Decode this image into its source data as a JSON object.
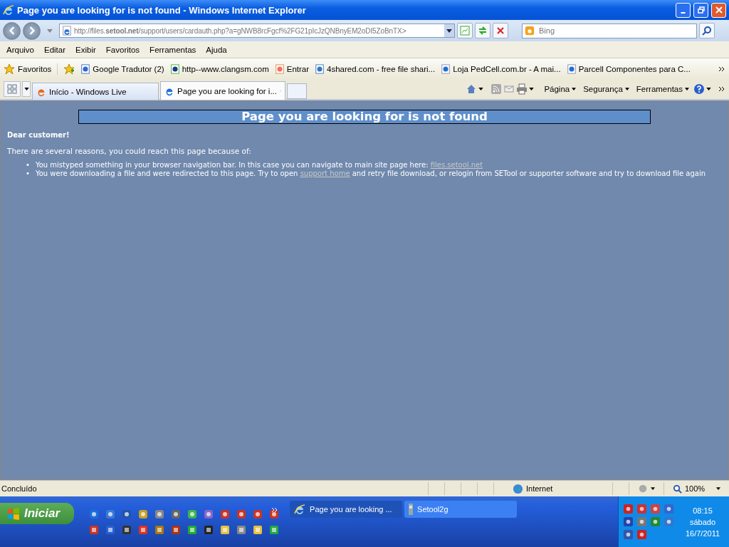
{
  "window": {
    "title": "Page you are looking for is not found - Windows Internet Explorer"
  },
  "address_bar": {
    "url": "http://files.**setool.net**/support/users/cardauth.php?a=gNWB8rcFgcf%2FG21pIcJzQNBnyEM2oDI5ZoBnTX>"
  },
  "search": {
    "placeholder": "Bing"
  },
  "menu": [
    "Arquivo",
    "Editar",
    "Exibir",
    "Favoritos",
    "Ferramentas",
    "Ajuda"
  ],
  "favorites_bar": {
    "label": "Favoritos",
    "links": [
      "Google Tradutor (2)",
      "http--www.clangsm.com",
      "Entrar",
      "4shared.com - free file shari...",
      "Loja PedCell.com.br - A mai...",
      "Parcell Componentes para C..."
    ]
  },
  "tabs": [
    {
      "title": "Início - Windows Live",
      "selected": false
    },
    {
      "title": "Page you are looking for i...",
      "selected": true
    }
  ],
  "command_bar": [
    "Página",
    "Segurança",
    "Ferramentas"
  ],
  "page": {
    "heading": "Page you are looking for is not found",
    "greeting": "Dear customer!",
    "intro": "There are several reasons, you could reach this page because of:",
    "reasons": [
      {
        "marker": "•",
        "text": "You mistyped something in your browser navigation bar. In this case you can navigate to main site page here: ",
        "link": "files.setool.net"
      },
      {
        "marker": "•",
        "text": "You were downloading a file and were redirected to this page. Try to open ",
        "link": "support home",
        "after": " and retry file download, or relogin from SETool or supporter software and try to download file again"
      }
    ]
  },
  "status_bar": {
    "status": "Concluído",
    "zone": "Internet",
    "zoom": "100%"
  },
  "taskbar": {
    "start": "Iniciar",
    "windows": [
      {
        "title": "Page you are looking ...",
        "selected": true
      },
      {
        "title": "Setool2g",
        "selected": false
      }
    ],
    "time": "08:15",
    "day": "sábado",
    "date": "16/7/2011"
  }
}
